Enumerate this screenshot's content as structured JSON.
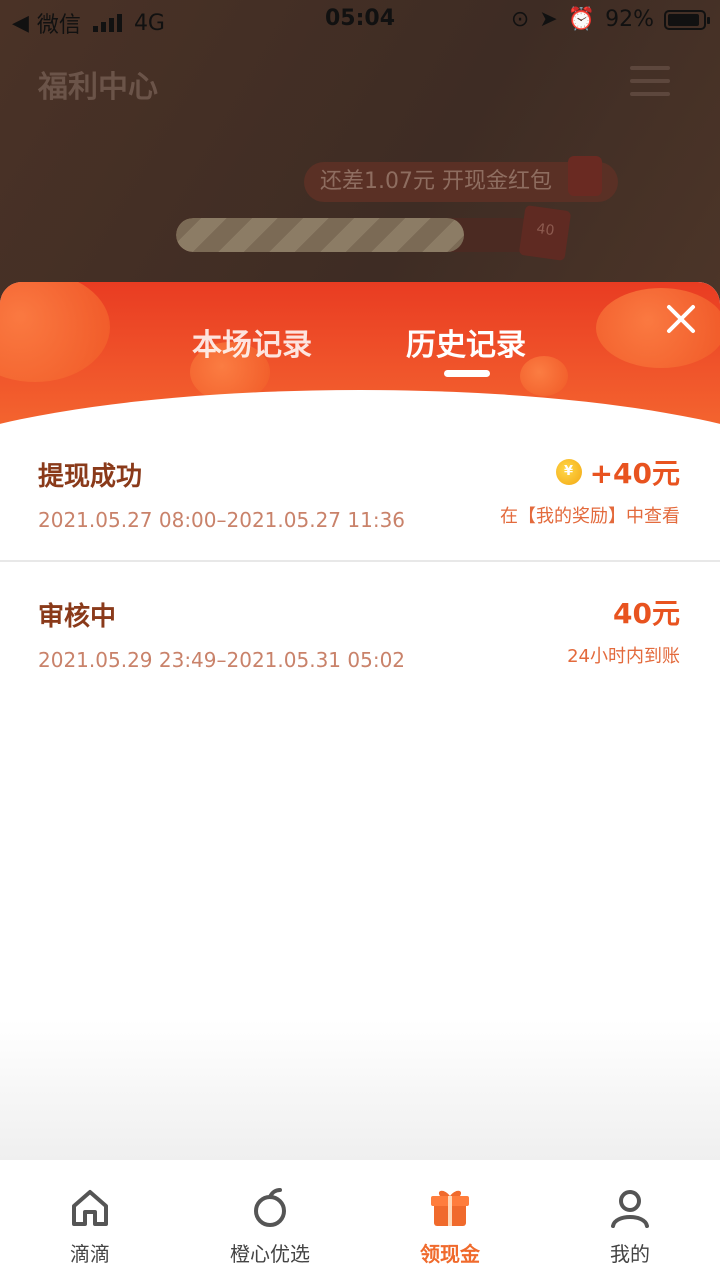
{
  "status_bar": {
    "carrier": "微信",
    "network": "4G",
    "time": "05:04",
    "battery": "92%",
    "battery_level": 0.92
  },
  "background_page": {
    "title": "福利中心",
    "bubble_text": "还差1.07元 开现金红包",
    "progress": 0.8,
    "card_value": "40"
  },
  "sheet": {
    "tabs": [
      {
        "label": "本场记录",
        "active": false
      },
      {
        "label": "历史记录",
        "active": true
      }
    ],
    "records": [
      {
        "title": "提现成功",
        "time": "2021.05.27 08:00–2021.05.27 11:36",
        "amount": "+40元",
        "note": "在【我的奖励】中查看",
        "coin": "¥"
      },
      {
        "title": "审核中",
        "time": "2021.05.29 23:49–2021.05.31 05:02",
        "amount": "40元",
        "note": "24小时内到账"
      }
    ]
  },
  "bottom_nav": [
    {
      "label": "滴滴",
      "icon": "home-icon"
    },
    {
      "label": "橙心优选",
      "icon": "orange-icon"
    },
    {
      "label": "领现金",
      "icon": "gift-icon",
      "active": true
    },
    {
      "label": "我的",
      "icon": "user-icon"
    }
  ],
  "colors": {
    "accent": "#f06a2c",
    "header_red": "#e93c22",
    "title_brown": "#8a3a1a"
  }
}
